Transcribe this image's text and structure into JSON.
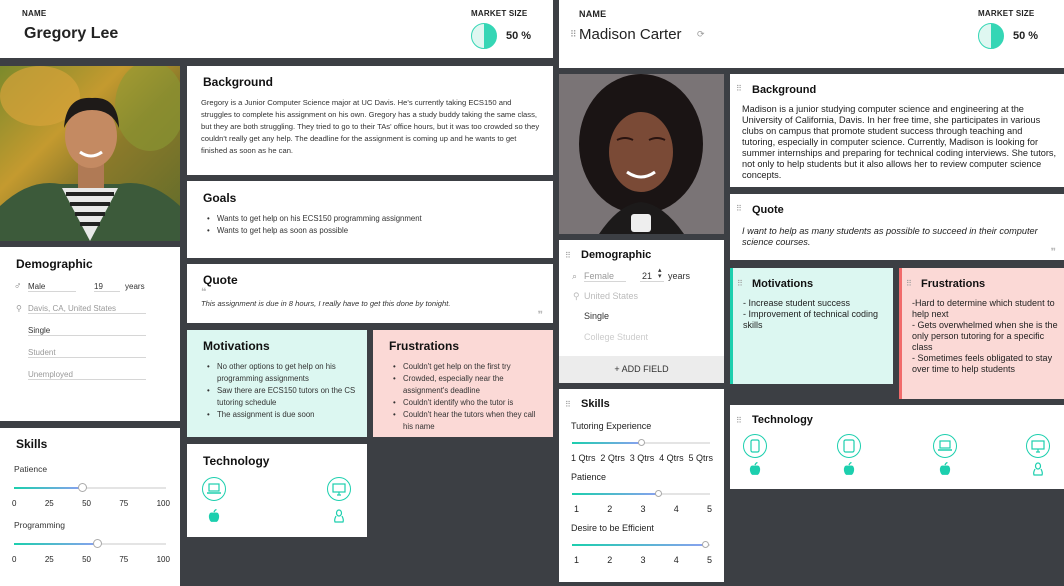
{
  "left": {
    "header": {
      "name_label": "NAME",
      "name": "Gregory Lee",
      "market_label": "MARKET SIZE",
      "market_value": "50 %",
      "market_fraction": 0.5
    },
    "background": {
      "title": "Background",
      "text": "Gregory is a Junior Computer Science major at UC Davis. He's currently taking ECS150 and struggles to complete his assignment on his own. Gregory has a study buddy taking the same class, but they are both struggling. They tried to go to their TAs' office hours, but it was too crowded so they couldn't really get any help. The deadline for the assignment is coming up and he wants to get finished as soon as he can."
    },
    "goals": {
      "title": "Goals",
      "items": [
        "Wants to get help on his ECS150 programming assignment",
        "Wants to get help as soon as possible"
      ]
    },
    "quote": {
      "title": "Quote",
      "text": "This assignment is due in 8 hours, I really have to get this done by tonight."
    },
    "motivations": {
      "title": "Motivations",
      "items": [
        "No other options to get help on his programming assignments",
        "Saw there are ECS150 tutors on the CS tutoring schedule",
        "The assignment is due soon"
      ]
    },
    "frustrations": {
      "title": "Frustrations",
      "items": [
        "Couldn't get help on the first try",
        "Crowded, especially near the assignment's deadline",
        "Couldn't identify who the tutor is",
        "Couldn't hear the tutors when they call his name"
      ]
    },
    "demographic": {
      "title": "Demographic",
      "gender": "Male",
      "age": "19",
      "age_unit": "years",
      "location": "Davis, CA, United States",
      "status": "Single",
      "occupation": "Student",
      "employment": "Unemployed"
    },
    "skills": {
      "title": "Skills",
      "ticks": [
        "0",
        "25",
        "50",
        "75",
        "100"
      ],
      "items": [
        {
          "label": "Patience",
          "value": 0.45
        },
        {
          "label": "Programming",
          "value": 0.55
        }
      ]
    },
    "technology": {
      "title": "Technology"
    }
  },
  "right": {
    "header": {
      "name_label": "NAME",
      "name": "Madison Carter",
      "market_label": "MARKET SIZE",
      "market_value": "50 %",
      "market_fraction": 0.5
    },
    "background": {
      "title": "Background",
      "text": "Madison is a junior studying computer science and engineering at the University of California, Davis. In her free time, she participates in various clubs on campus that promote student success through teaching and tutoring, especially in computer science. Currently, Madison is looking for summer internships and preparing for technical coding interviews. She tutors, not only to help students but it also allows her to review computer science concepts."
    },
    "quote": {
      "title": "Quote",
      "text": "I want to help as many students as possible to succeed in their computer science courses."
    },
    "demographic": {
      "title": "Demographic",
      "gender": "Female",
      "age": "21",
      "age_unit": "years",
      "location": "United States",
      "status": "Single",
      "occupation": "College Student",
      "add_field": "+ ADD FIELD"
    },
    "motivations": {
      "title": "Motivations",
      "lines": [
        "- Increase student success",
        "- Improvement of technical coding skills"
      ]
    },
    "frustrations": {
      "title": "Frustrations",
      "lines": [
        "-Hard to determine which student to help   next",
        "- Gets overwhelmed when she is the only    person tutoring for a specific class",
        "- Sometimes feels obligated to stay over      time to help students"
      ]
    },
    "skills": {
      "title": "Skills",
      "items": [
        {
          "label": "Tutoring Experience",
          "value": 0.5,
          "ticks": [
            "1 Qtrs",
            "2 Qtrs",
            "3 Qtrs",
            "4 Qtrs",
            "5 Qtrs"
          ]
        },
        {
          "label": "Patience",
          "value": 0.63,
          "ticks": [
            "1",
            "2",
            "3",
            "4",
            "5"
          ]
        },
        {
          "label": "Desire to be Efficient",
          "value": 0.97,
          "ticks": [
            "1",
            "2",
            "3",
            "4",
            "5"
          ]
        }
      ]
    },
    "technology": {
      "title": "Technology"
    }
  },
  "colors": {
    "accent": "#1ccfae",
    "mint": "#dcf7f1",
    "pink": "#fbd9d6",
    "bg": "#3c3f44"
  }
}
